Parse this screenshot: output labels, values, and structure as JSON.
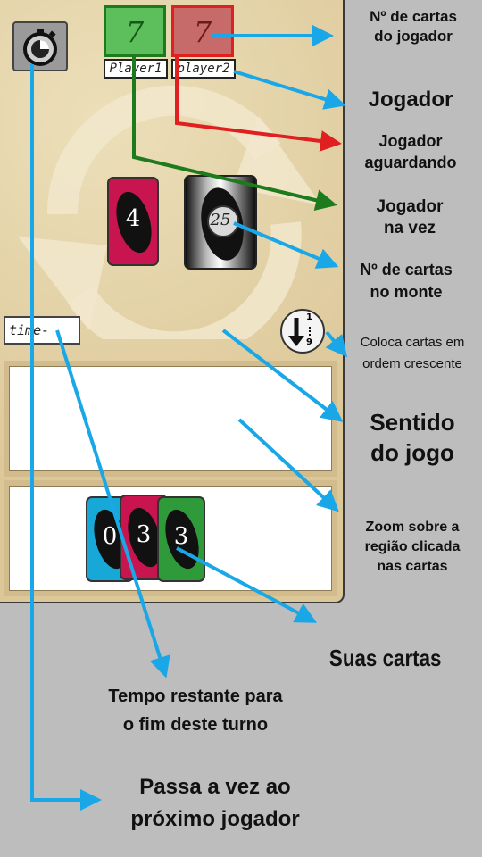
{
  "game": {
    "player1": {
      "name": "Player1",
      "cards": "7"
    },
    "player2": {
      "name": "player2",
      "cards": "7"
    },
    "last_card": "4",
    "deck_count": "25",
    "time_label": "time-",
    "sort_label_top": "1",
    "sort_label_bottom": "9",
    "hand": [
      "0",
      "3",
      "3"
    ]
  },
  "annotations": {
    "player_cards": "Nº de cartas\ndo jogador",
    "player": "Jogador",
    "waiting": "Jogador\naguardando",
    "current": "Jogador\nna vez",
    "deck": "Nº de cartas\nno monte",
    "sort": "Coloca cartas em\nordem crescente",
    "direction": "Sentido\ndo jogo",
    "zoom": "Zoom sobre a\nregião clicada\nnas cartas",
    "your_cards": "Suas cartas",
    "time_left": "Tempo restante para\no fim deste turno",
    "pass": "Passa a vez ao\npróximo jogador"
  },
  "colors": {
    "arrow_blue": "#1aa7e8",
    "green": "#1d7a1d",
    "red": "#e02020",
    "pink_card": "#c8144f",
    "cyan_card": "#18a8d8",
    "green_card": "#2f9a3a"
  }
}
